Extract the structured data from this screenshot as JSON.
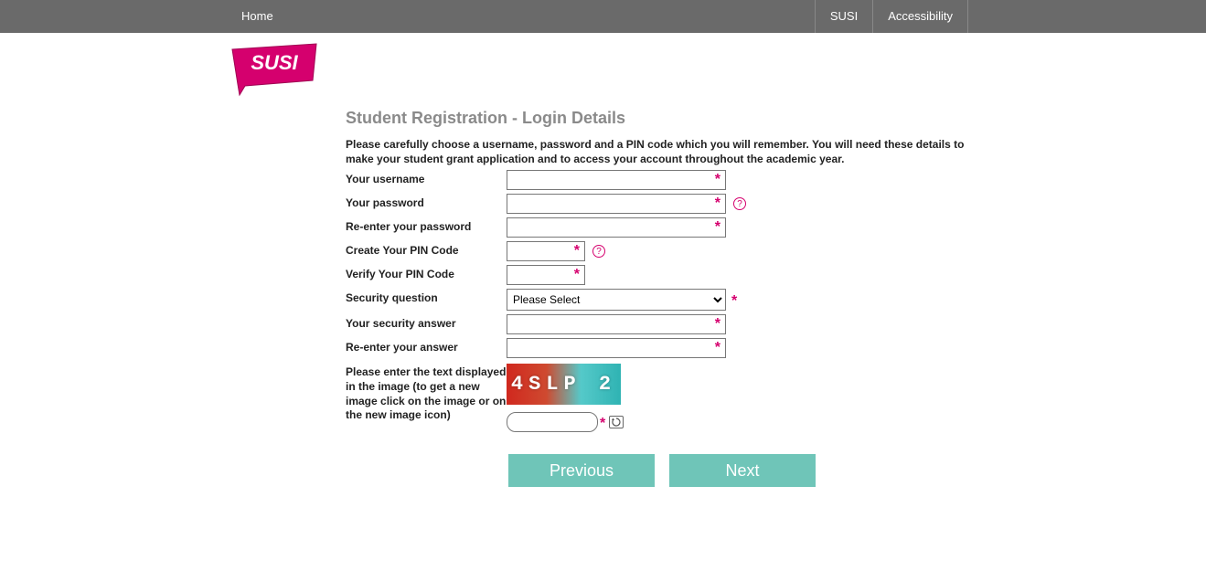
{
  "nav": {
    "home": "Home",
    "susi": "SUSI",
    "accessibility": "Accessibility"
  },
  "logo_text": "SUSI",
  "page_title": "Student Registration - Login Details",
  "intro": "Please carefully choose a username, password and a PIN code which you will remember. You will need these details to make your student grant application and to access your account throughout the academic year.",
  "labels": {
    "username": "Your username",
    "password": "Your password",
    "repassword": "Re-enter your password",
    "pin": "Create Your PIN Code",
    "repin": "Verify Your PIN Code",
    "security_q": "Security question",
    "security_a": "Your security answer",
    "resecurity_a": "Re-enter your answer",
    "captcha": "Please enter the text displayed in the image (to get a new image click on the image or on the new image icon)"
  },
  "security_placeholder": "Please Select",
  "captcha_text": "4SLP 2",
  "buttons": {
    "previous": "Previous",
    "next": "Next"
  },
  "required_mark": "*",
  "help_mark": "?"
}
